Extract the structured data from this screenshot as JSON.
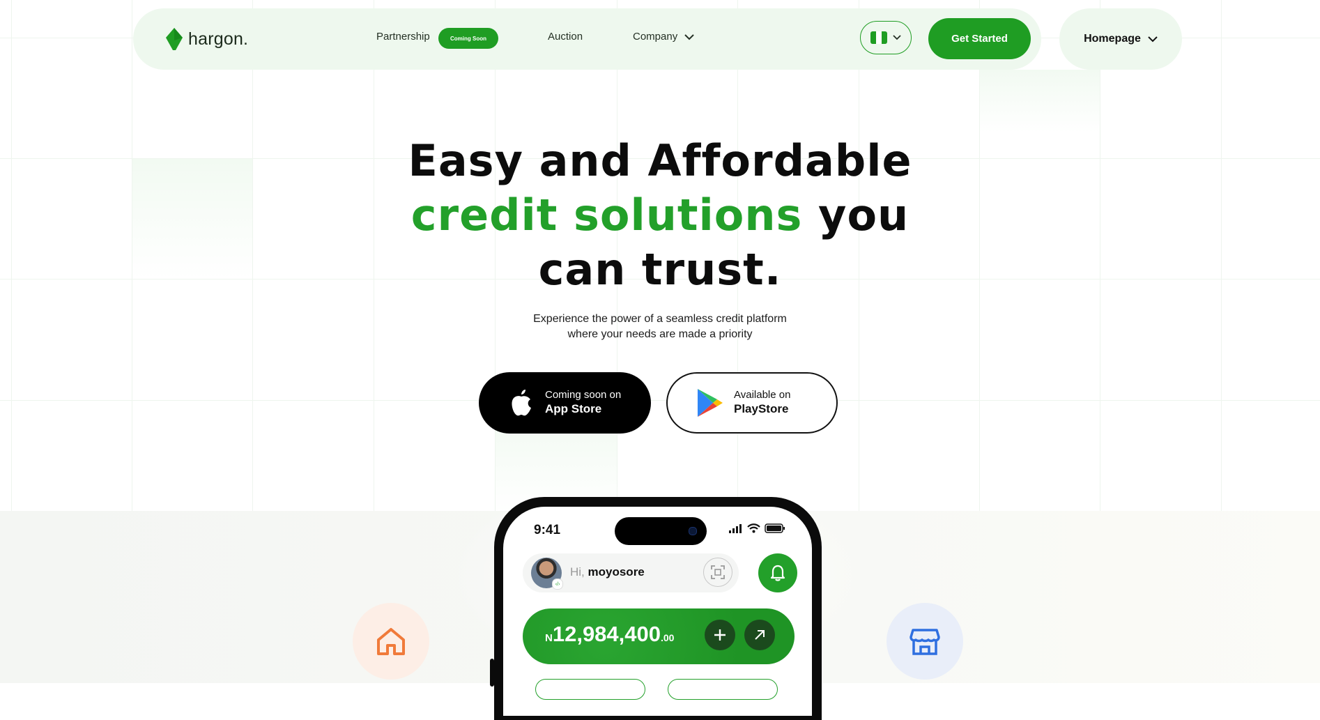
{
  "nav": {
    "brand": "hargon.",
    "links": [
      {
        "label": "Partnership",
        "badge": "Coming Soon"
      },
      {
        "label": "Auction"
      },
      {
        "label": "Company"
      }
    ],
    "cta": "Get Started",
    "homepage_label": "Homepage",
    "flag_colors": [
      "#1f9d23",
      "#ffffff",
      "#1f9d23"
    ]
  },
  "hero": {
    "line1": "Easy and Affordable",
    "line2_highlight": "credit solutions",
    "line2_rest": " you",
    "line3": "can trust.",
    "subtitle_1": "Experience the power of a seamless credit platform",
    "subtitle_2": "where your needs are made a priority"
  },
  "stores": {
    "apple": {
      "line1": "Coming soon on",
      "line2": "App Store"
    },
    "play": {
      "line1": "Available on",
      "line2": "PlayStore"
    }
  },
  "phone": {
    "time": "9:41",
    "greeting": "Hi,",
    "username": "moyosore",
    "balance": {
      "currency": "N",
      "amount": "12,984,400",
      "decimals": ".00"
    }
  },
  "colors": {
    "accent": "#23a02a",
    "nav_bg": "#eef8ee",
    "text": "#0c0c0c"
  },
  "icons": [
    "hargon-logo-icon",
    "chevron-down-icon",
    "flag-icon",
    "apple-icon",
    "play-store-icon",
    "signal-icon",
    "wifi-icon",
    "battery-icon",
    "scan-icon",
    "bell-icon",
    "plus-icon",
    "arrow-up-right-icon",
    "home-icon",
    "shop-icon"
  ]
}
